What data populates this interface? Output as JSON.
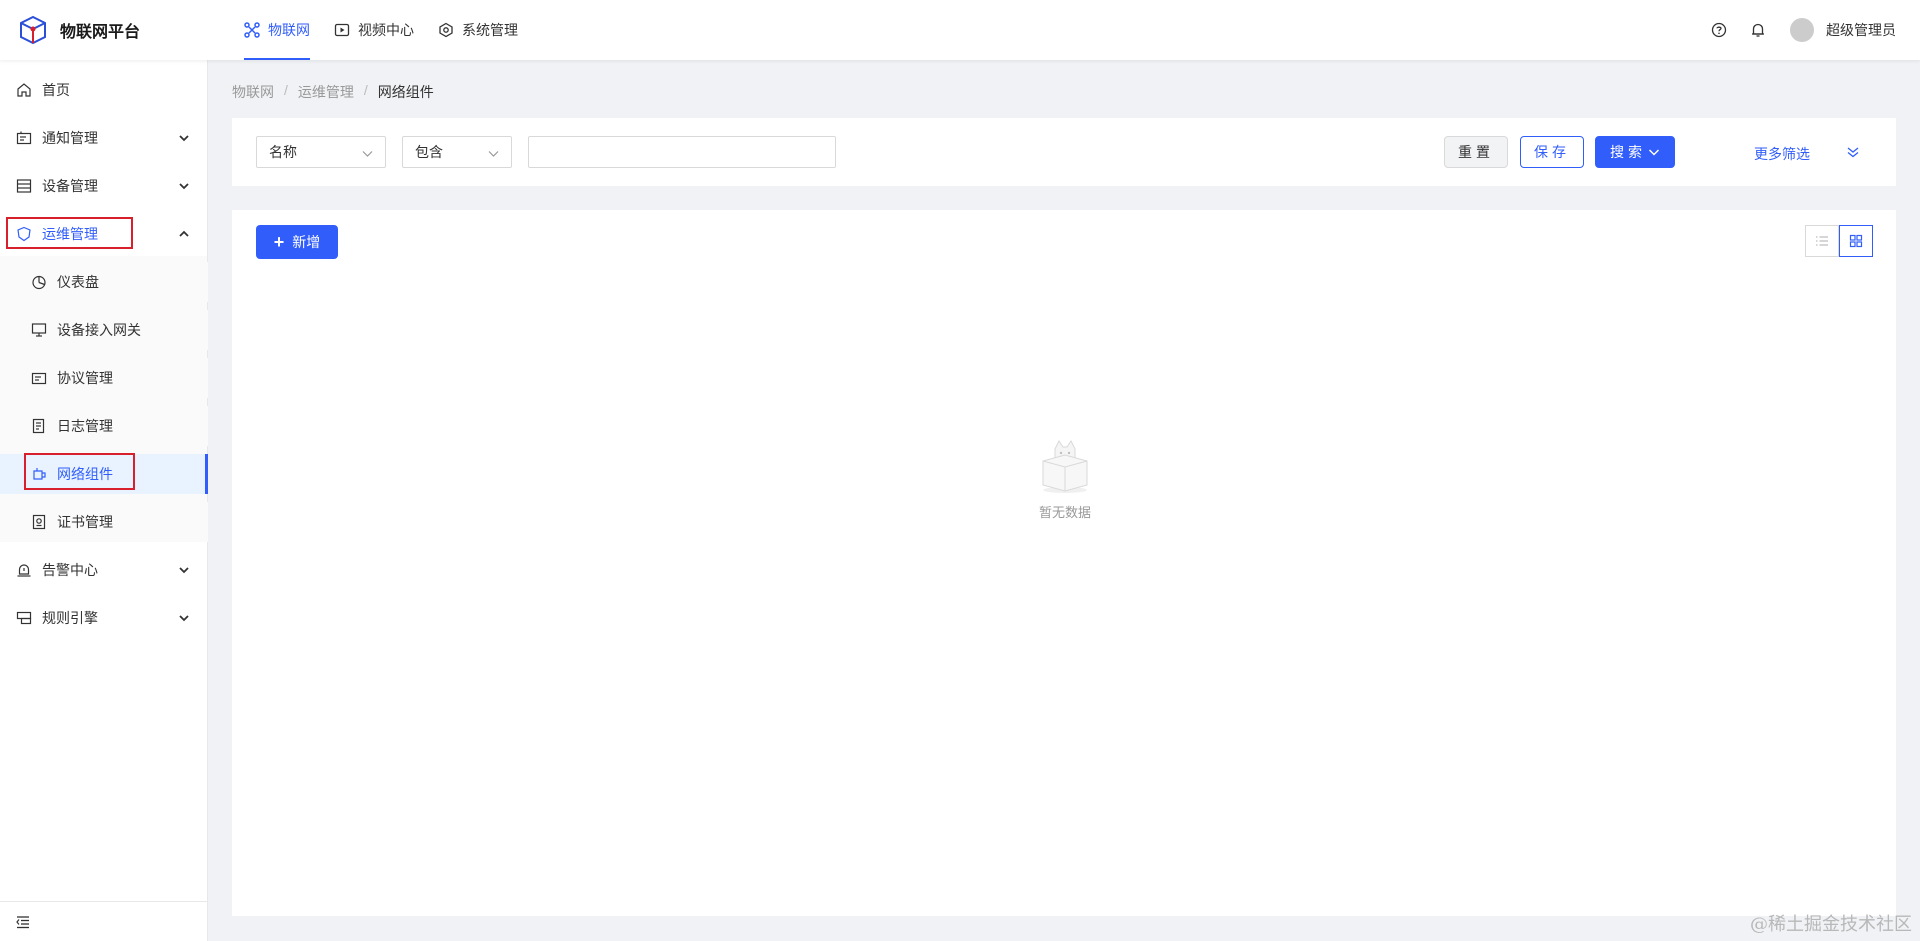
{
  "app": {
    "title": "物联网平台"
  },
  "topnav": [
    {
      "label": "物联网",
      "icon": "iot-icon",
      "active": true
    },
    {
      "label": "视频中心",
      "icon": "video-play-icon",
      "active": false
    },
    {
      "label": "系统管理",
      "icon": "system-settings-icon",
      "active": false
    }
  ],
  "header": {
    "username": "超级管理员"
  },
  "sidebar": {
    "home": "首页",
    "notify": "通知管理",
    "device": "设备管理",
    "ops": "运维管理",
    "ops_children": {
      "dashboard": "仪表盘",
      "gateway": "设备接入网关",
      "protocol": "协议管理",
      "log": "日志管理",
      "network": "网络组件",
      "cert": "证书管理"
    },
    "alarm": "告警中心",
    "rule": "规则引擎"
  },
  "breadcrumb": [
    "物联网",
    "运维管理",
    "网络组件"
  ],
  "filter": {
    "field": "名称",
    "operator": "包含",
    "value": "",
    "reset": "重置",
    "save": "保存",
    "search": "搜索",
    "more": "更多筛选"
  },
  "toolbar": {
    "add": "新增"
  },
  "empty": {
    "text": "暂无数据"
  },
  "watermark": "@稀土掘金技术社区",
  "colors": {
    "primary": "#315efb",
    "highlight": "#d8202c"
  }
}
